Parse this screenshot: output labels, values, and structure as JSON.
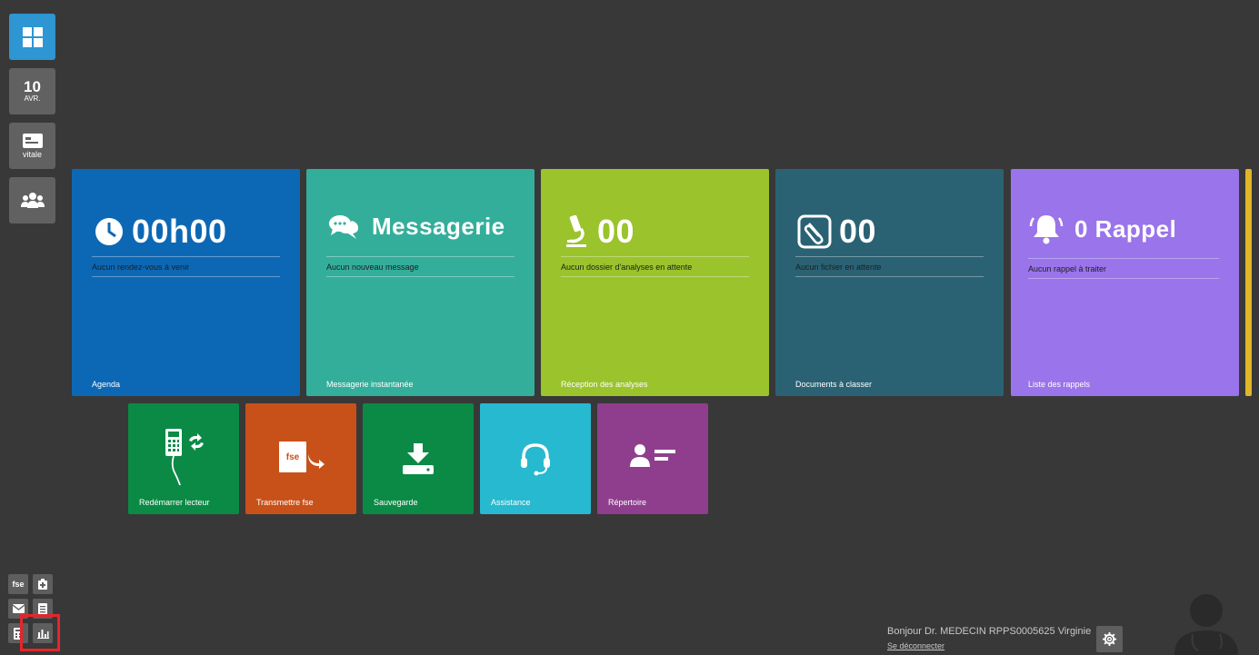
{
  "sidebar": {
    "date_day": "10",
    "date_month": "AVR.",
    "vitale_label": "vitale"
  },
  "tiles": {
    "agenda": {
      "value": "00h00",
      "sub": "Aucun rendez-vous à venir",
      "label": "Agenda",
      "color": "#0c68b5"
    },
    "messagerie": {
      "value": "Messagerie",
      "sub": "Aucun nouveau message",
      "label": "Messagerie instantanée",
      "color": "#33ae9b"
    },
    "analyses": {
      "value": "00",
      "sub": "Aucun dossier d'analyses en attente",
      "label": "Réception des analyses",
      "color": "#9bc32c"
    },
    "documents": {
      "value": "00",
      "sub": "Aucun fichier en attente",
      "label": "Documents à classer",
      "color": "#2a6274"
    },
    "rappels": {
      "value": "0 Rappel",
      "sub": "Aucun rappel à traiter",
      "label": "Liste des rappels",
      "color": "#9a74ea"
    }
  },
  "actions": {
    "lecteur": {
      "label": "Redémarrer lecteur",
      "color": "#0b8a46"
    },
    "fse": {
      "label": "Transmettre fse",
      "icon_text": "fse",
      "color": "#c8511a"
    },
    "sauvegarde": {
      "label": "Sauvegarde",
      "color": "#0b8a46"
    },
    "assistance": {
      "label": "Assistance",
      "color": "#27b9cf"
    },
    "repertoire": {
      "label": "Répertoire",
      "color": "#8f3e8e"
    }
  },
  "bottom_tools": {
    "fse_label": "fse"
  },
  "user": {
    "greeting": "Bonjour Dr. MEDECIN RPPS0005625 Virginie",
    "logout": "Se déconnecter"
  }
}
